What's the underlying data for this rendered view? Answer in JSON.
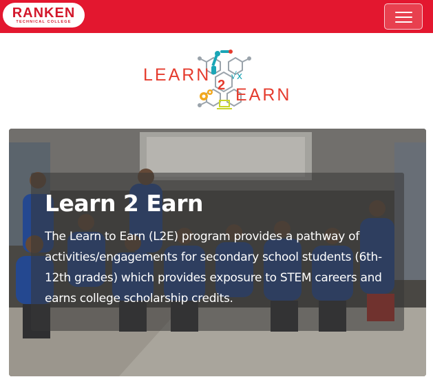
{
  "navbar": {
    "brand": {
      "name": "RANKEN",
      "subtitle": "TECHNICAL COLLEGE"
    },
    "toggle_icon": "hamburger-menu-icon",
    "colors": {
      "background": "#e3172f",
      "brand_text": "#d3172b"
    }
  },
  "logo": {
    "word_left": "LEARN",
    "number": "2",
    "word_right": "EARN",
    "math_symbol": "√x",
    "icons": [
      "robot-arm-icon",
      "gears-icon",
      "laptop-icon",
      "sqrt-icon"
    ],
    "colors": {
      "text": "#e53c2e",
      "robot": "#1aa6b7",
      "gears": "#f2a81d",
      "laptop": "#c9d42a",
      "circuit": "#9aa3ab"
    }
  },
  "hero": {
    "title": "Learn 2 Earn",
    "description": "The Learn to Earn (L2E) program provides a pathway of activities/engagements for secondary school students (6th-12th grades) which provides exposure to STEM careers and earns college scholarship credits."
  }
}
